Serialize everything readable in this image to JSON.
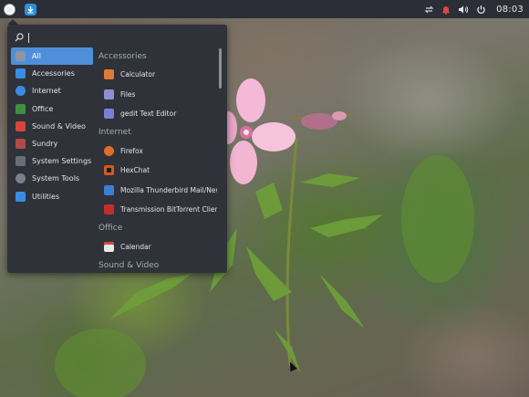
{
  "topbar": {
    "clock": "08:03",
    "tray_icons": [
      "network-icon",
      "notification-bell-icon",
      "volume-icon",
      "power-icon"
    ]
  },
  "menu": {
    "search": {
      "value": "",
      "placeholder": ""
    },
    "categories": [
      {
        "label": "All",
        "icon": "all-icon",
        "color": "#8e95a3",
        "selected": true
      },
      {
        "label": "Accessories",
        "icon": "accessories-icon",
        "color": "#3a8be3"
      },
      {
        "label": "Internet",
        "icon": "internet-icon",
        "color": "#3a8be3"
      },
      {
        "label": "Office",
        "icon": "office-icon",
        "color": "#3f8f3f"
      },
      {
        "label": "Sound & Video",
        "icon": "sound-video-icon",
        "color": "#d9443b"
      },
      {
        "label": "Sundry",
        "icon": "sundry-icon",
        "color": "#b04a4a"
      },
      {
        "label": "System Settings",
        "icon": "system-settings-icon",
        "color": "#6a6e78"
      },
      {
        "label": "System Tools",
        "icon": "system-tools-icon",
        "color": "#7a7f89"
      },
      {
        "label": "Utilities",
        "icon": "utilities-icon",
        "color": "#3a8be3"
      }
    ],
    "sections": [
      {
        "title": "Accessories",
        "apps": [
          {
            "label": "Calculator",
            "icon": "calculator-icon",
            "color": "#e07b32"
          },
          {
            "label": "Files",
            "icon": "files-icon",
            "color": "#8f8fd6"
          },
          {
            "label": "gedit Text Editor",
            "icon": "text-editor-icon",
            "color": "#7a7fd6"
          }
        ]
      },
      {
        "title": "Internet",
        "apps": [
          {
            "label": "Firefox",
            "icon": "firefox-icon",
            "color": "#e26d2a"
          },
          {
            "label": "HexChat",
            "icon": "hexchat-icon",
            "color": "#d05a20"
          },
          {
            "label": "Mozilla Thunderbird Mail/News",
            "icon": "thunderbird-icon",
            "color": "#3a7fd5"
          },
          {
            "label": "Transmission BitTorrent Client",
            "icon": "transmission-icon",
            "color": "#c42d2d"
          }
        ]
      },
      {
        "title": "Office",
        "apps": [
          {
            "label": "Calendar",
            "icon": "calendar-icon",
            "color": "#d9d9d9"
          }
        ]
      },
      {
        "title": "Sound & Video",
        "apps": []
      }
    ]
  }
}
